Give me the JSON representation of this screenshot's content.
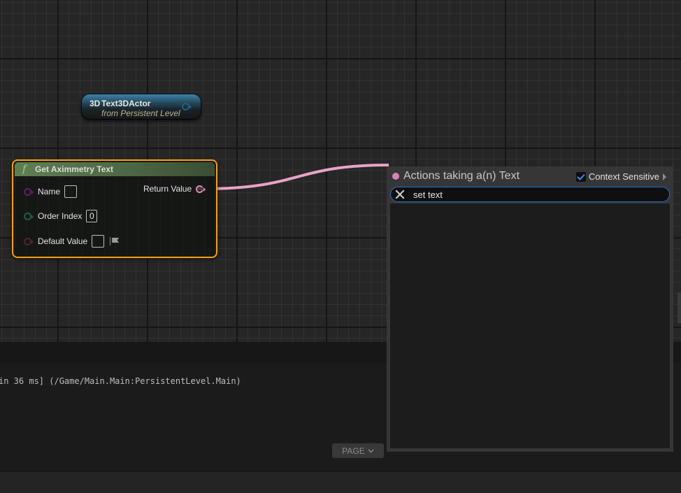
{
  "graph": {
    "actor_node": {
      "badge": "3D",
      "title": "Text3DActor",
      "subtitle": "from Persistent Level"
    },
    "function_node": {
      "icon": "function-icon",
      "title": "Get Aximmetry Text",
      "inputs": [
        {
          "label": "Name",
          "type": "string",
          "value": ""
        },
        {
          "label": "Order Index",
          "type": "integer",
          "value": "0"
        },
        {
          "label": "Default Value",
          "type": "text",
          "value": ""
        }
      ],
      "output": {
        "label": "Return Value",
        "type": "text"
      },
      "selected": true
    },
    "colors": {
      "selection_border": "#f5a300",
      "function_header": "#5f7f52",
      "text_pin": "#e58bbd",
      "string_pin": "#6a1a5e",
      "integer_pin": "#1d5e4c",
      "object_pin": "#1f5f86"
    }
  },
  "log": {
    "line": "in 36 ms] (/Game/Main.Main:PersistentLevel.Main)",
    "page_button": "PAGE"
  },
  "action_menu": {
    "title": "Actions taking a(n) Text",
    "context_sensitive_label": "Context Sensitive",
    "context_sensitive_checked": true,
    "search_value": "set text",
    "search_placeholder": "",
    "results": [],
    "accent_color": "#1d6fd0"
  }
}
